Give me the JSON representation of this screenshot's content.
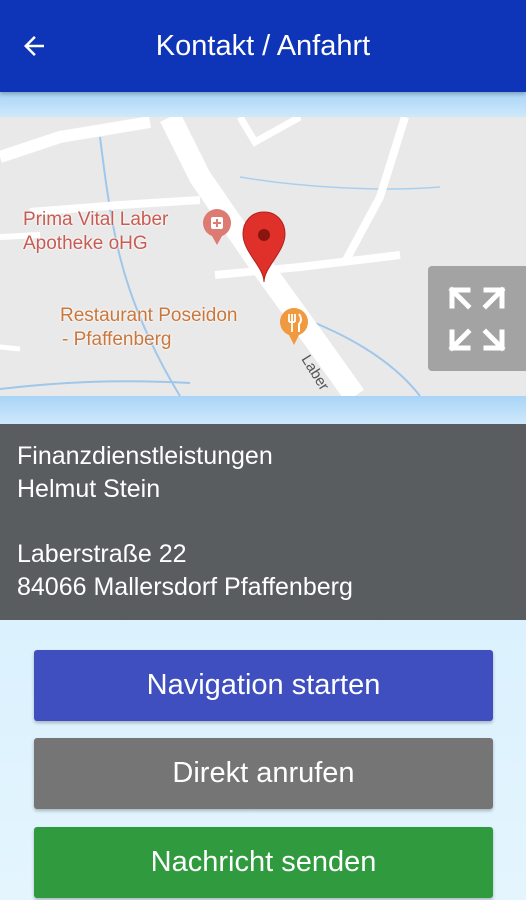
{
  "appbar": {
    "title": "Kontakt / Anfahrt",
    "back_icon": "arrow-left-icon",
    "color": "#0e35b8"
  },
  "map": {
    "pois": [
      {
        "name_line1": "Prima Vital Laber",
        "name_line2": "Apotheke oHG",
        "icon": "pharmacy-icon",
        "color": "#c75c53"
      },
      {
        "name_line1": "Restaurant Poseidon",
        "name_line2": "- Pfaffenberg",
        "icon": "restaurant-icon",
        "color": "#c9773c"
      }
    ],
    "road_label": "Laber",
    "marker_icon": "map-pin-icon",
    "fullscreen_icon": "fullscreen-icon"
  },
  "contact": {
    "company": "Finanzdienstleistungen",
    "person": "Helmut Stein",
    "street": "Laberstraße 22",
    "city": "84066 Mallersdorf Pfaffenberg"
  },
  "buttons": {
    "navigation": {
      "label": "Navigation starten",
      "color": "#3f4fbf"
    },
    "call": {
      "label": "Direkt anrufen",
      "color": "#757575"
    },
    "message": {
      "label": "Nachricht senden",
      "color": "#2f9a3e"
    }
  }
}
